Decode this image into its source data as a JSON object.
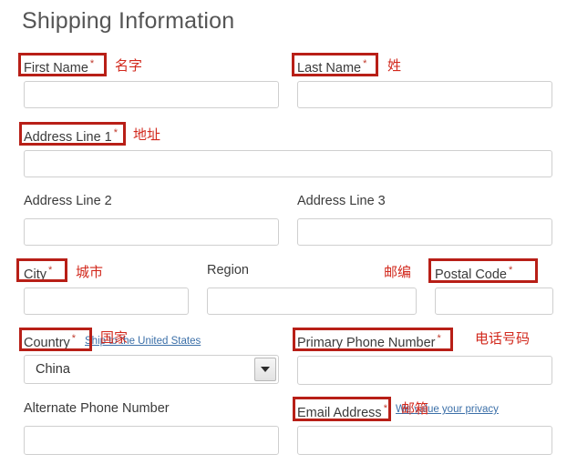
{
  "page": {
    "title": "Shipping Information"
  },
  "fields": {
    "first_name": {
      "label": "First Name",
      "required": true,
      "value": "",
      "cn": "名字"
    },
    "last_name": {
      "label": "Last Name",
      "required": true,
      "value": "",
      "cn": "姓"
    },
    "address1": {
      "label": "Address Line 1",
      "required": true,
      "value": "",
      "cn": "地址"
    },
    "address2": {
      "label": "Address Line 2",
      "required": false,
      "value": ""
    },
    "address3": {
      "label": "Address Line 3",
      "required": false,
      "value": ""
    },
    "city": {
      "label": "City",
      "required": true,
      "value": "",
      "cn": "城市"
    },
    "region": {
      "label": "Region",
      "required": false,
      "value": ""
    },
    "postal_code": {
      "label": "Postal Code",
      "required": true,
      "value": "",
      "cn": "邮编"
    },
    "country": {
      "label": "Country",
      "required": true,
      "value": "China",
      "cn": "国家"
    },
    "primary_phone": {
      "label": "Primary Phone Number",
      "required": true,
      "value": "",
      "cn": "电话号码"
    },
    "alternate_phone": {
      "label": "Alternate Phone Number",
      "required": false,
      "value": ""
    },
    "email": {
      "label": "Email Address",
      "required": true,
      "value": "",
      "cn": "邮箱"
    }
  },
  "links": {
    "ship_to_us": "Ship to the United States",
    "privacy": "We value your privacy"
  },
  "required_marker": "*",
  "colors": {
    "annotation_border": "#b81f17",
    "annotation_text": "#d2291d",
    "required_star": "#c0392b",
    "link": "#3b6fa8",
    "input_border": "#cfcfcf",
    "title": "#555555"
  }
}
